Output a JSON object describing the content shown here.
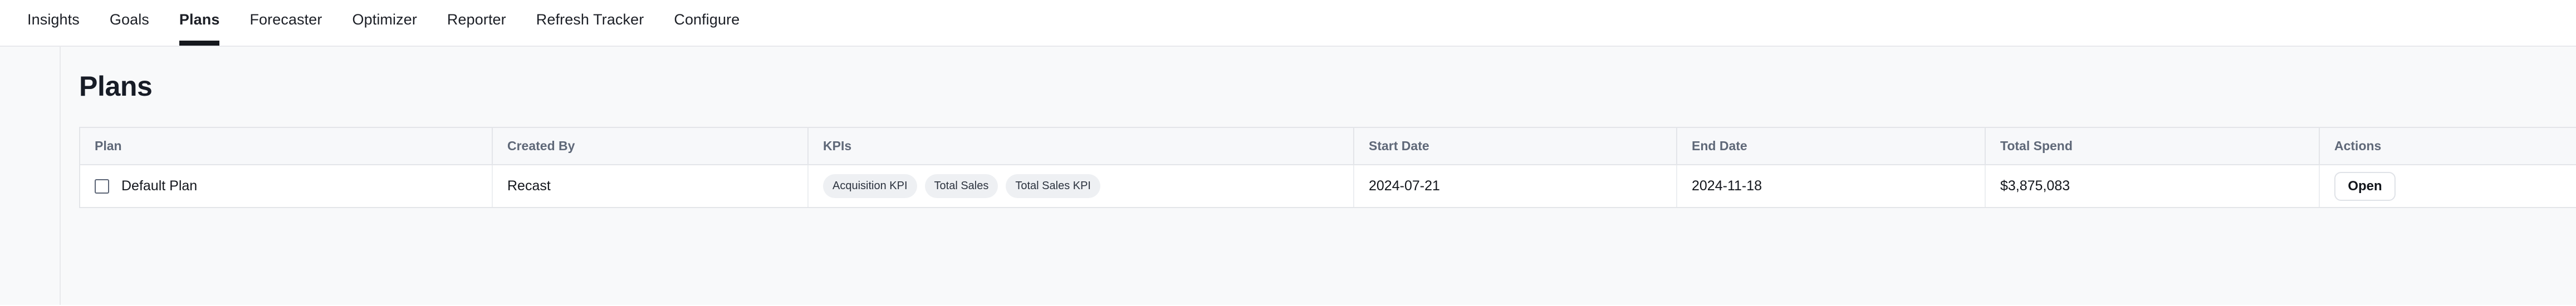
{
  "nav": {
    "items": [
      {
        "label": "Insights",
        "active": false
      },
      {
        "label": "Goals",
        "active": false
      },
      {
        "label": "Plans",
        "active": true
      },
      {
        "label": "Forecaster",
        "active": false
      },
      {
        "label": "Optimizer",
        "active": false
      },
      {
        "label": "Reporter",
        "active": false
      },
      {
        "label": "Refresh Tracker",
        "active": false
      },
      {
        "label": "Configure",
        "active": false
      }
    ]
  },
  "page": {
    "title": "Plans"
  },
  "table": {
    "columns": [
      {
        "key": "plan",
        "label": "Plan"
      },
      {
        "key": "created_by",
        "label": "Created By"
      },
      {
        "key": "kpis",
        "label": "KPIs"
      },
      {
        "key": "start_date",
        "label": "Start Date"
      },
      {
        "key": "end_date",
        "label": "End Date"
      },
      {
        "key": "total_spend",
        "label": "Total Spend"
      },
      {
        "key": "actions",
        "label": "Actions"
      }
    ],
    "rows": [
      {
        "selected": false,
        "plan": "Default Plan",
        "created_by": "Recast",
        "kpis": [
          "Acquisition KPI",
          "Total Sales",
          "Total Sales KPI"
        ],
        "start_date": "2024-07-21",
        "end_date": "2024-11-18",
        "total_spend": "$3,875,083",
        "action_label": "Open"
      }
    ]
  },
  "colors": {
    "page_bg": "#f8f9fa",
    "header_bg": "#f7f8fa",
    "border": "#e3e5e9",
    "text": "#13161c",
    "muted_text": "#5f6878",
    "pill_bg": "#eef0f3",
    "active_underline": "#15181d"
  }
}
